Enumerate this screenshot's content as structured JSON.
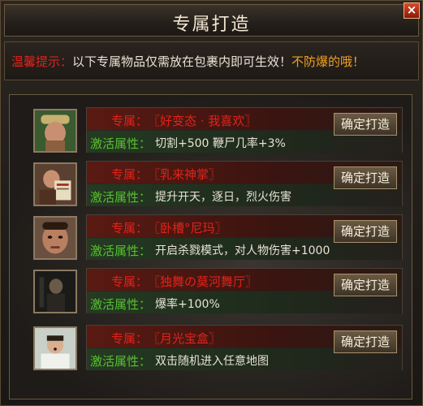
{
  "window": {
    "title": "专属打造",
    "close_label": "×"
  },
  "tip": {
    "label": "温馨提示：",
    "text": "以下专属物品仅需放在包裹内即可生效！",
    "warning": "不防爆的哦！"
  },
  "items": [
    {
      "exclusive_label": "专属：",
      "name": "〖好变态 · 我喜欢〗",
      "attr_label": "激活属性：",
      "attr_value": "切割+500  鞭尸几率+3%",
      "button": "确定打造",
      "portrait_icon": "man-straw-hat-portrait"
    },
    {
      "exclusive_label": "专属：",
      "name": "〖乳来神掌〗",
      "attr_label": "激活属性：",
      "attr_value": "提升开天，逐日，烈火伤害",
      "button": "确定打造",
      "portrait_icon": "man-holding-book-portrait"
    },
    {
      "exclusive_label": "专属：",
      "name": "〖卧槽°尼玛〗",
      "attr_label": "激活属性：",
      "attr_value": "开启杀戮模式，对人物伤害+1000",
      "button": "确定打造",
      "portrait_icon": "man-face-portrait"
    },
    {
      "exclusive_label": "专属：",
      "name": "〖独舞の莫河舞厅〗",
      "attr_label": "激活属性：",
      "attr_value": "爆率+100%",
      "button": "确定打造",
      "portrait_icon": "dark-figure-portrait"
    },
    {
      "exclusive_label": "专属：",
      "name": "〖月光宝盒〗",
      "attr_label": "激活属性：",
      "attr_value": "双击随机进入任意地图",
      "button": "确定打造",
      "portrait_icon": "startled-man-portrait"
    }
  ],
  "colors": {
    "red_text": "#e0231b",
    "green_text": "#58c030",
    "warning_text": "#f0a020",
    "frame": "#6a5a40"
  }
}
